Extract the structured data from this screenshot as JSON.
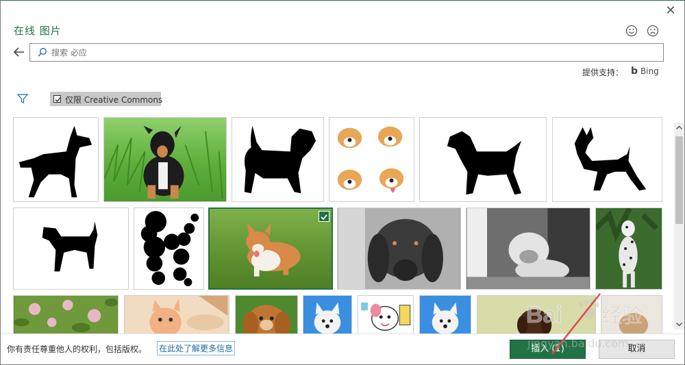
{
  "dialog": {
    "title": "在线 图片",
    "close_glyph": "✕"
  },
  "search": {
    "value": "",
    "placeholder": "搜索 必应"
  },
  "powered_by": {
    "label": "提供支持：",
    "brand": "Bing",
    "brand_glyph": "b"
  },
  "filter": {
    "creative_commons_label": "仅限 Creative Commons",
    "creative_commons_checked": true
  },
  "results": {
    "selected_index": 10
  },
  "footer": {
    "notice": "你有责任尊重他人的权利，包括版权。",
    "learn_more": "在此处了解更多信息",
    "insert_label": "插入 (1)",
    "cancel_label": "取消"
  },
  "watermark": {
    "brand": "Bai",
    "brand_suffix": "经验",
    "url": "jingyan.baidu.com"
  },
  "colors": {
    "accent": "#217346",
    "link": "#1e6aa5"
  }
}
